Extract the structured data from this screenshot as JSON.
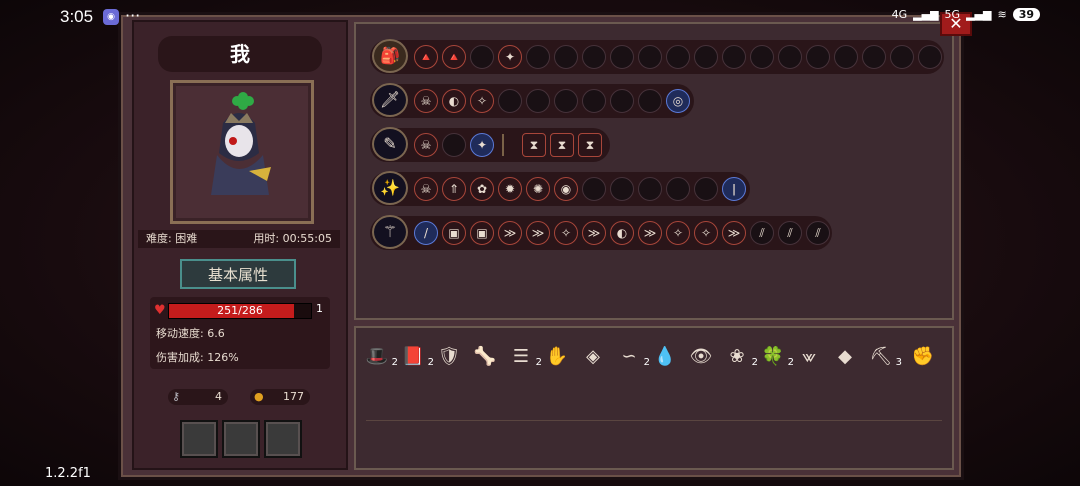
{
  "status": {
    "time": "3:05",
    "dots": "···",
    "net1": "4G",
    "net2": "5G",
    "battery": "39"
  },
  "close_label": "✕",
  "player": {
    "name": "我",
    "difficulty": "难度: 困难",
    "time": "用时: 00:55:05",
    "attr_button": "基本属性"
  },
  "stats": {
    "hp_text": "251/286",
    "hp_fraction": 0.878,
    "level": "1",
    "move_speed": "移动速度: 6.6",
    "damage_bonus": "伤害加成: 126%"
  },
  "resources": {
    "keys": "4",
    "coins": "177"
  },
  "weapons": [
    {
      "icon": "backpack-icon",
      "gems": [
        "filled",
        "filled",
        "empty",
        "filled"
      ]
    },
    {
      "icon": "sword-icon"
    },
    {
      "icon": "staff-icon"
    },
    {
      "icon": "wand-icon"
    },
    {
      "icon": "scepter-icon"
    }
  ],
  "items": [
    {
      "icon": "hat-icon",
      "count": "2"
    },
    {
      "icon": "book-icon",
      "count": "2"
    },
    {
      "icon": "mask-icon",
      "count": ""
    },
    {
      "icon": "bone-icon",
      "count": ""
    },
    {
      "icon": "ribcage-icon",
      "count": "2"
    },
    {
      "icon": "glove-icon",
      "count": ""
    },
    {
      "icon": "crystal-icon",
      "count": ""
    },
    {
      "icon": "hook-icon",
      "count": "2"
    },
    {
      "icon": "drop-icon",
      "count": ""
    },
    {
      "icon": "eye-icon",
      "count": ""
    },
    {
      "icon": "lotus-icon",
      "count": "2"
    },
    {
      "icon": "clover-icon",
      "count": "2"
    },
    {
      "icon": "fangs-icon",
      "count": ""
    },
    {
      "icon": "amulet-icon",
      "count": ""
    },
    {
      "icon": "pickaxe-icon",
      "count": "3"
    },
    {
      "icon": "gauntlet-icon",
      "count": ""
    }
  ],
  "version": "1.2.2f1"
}
